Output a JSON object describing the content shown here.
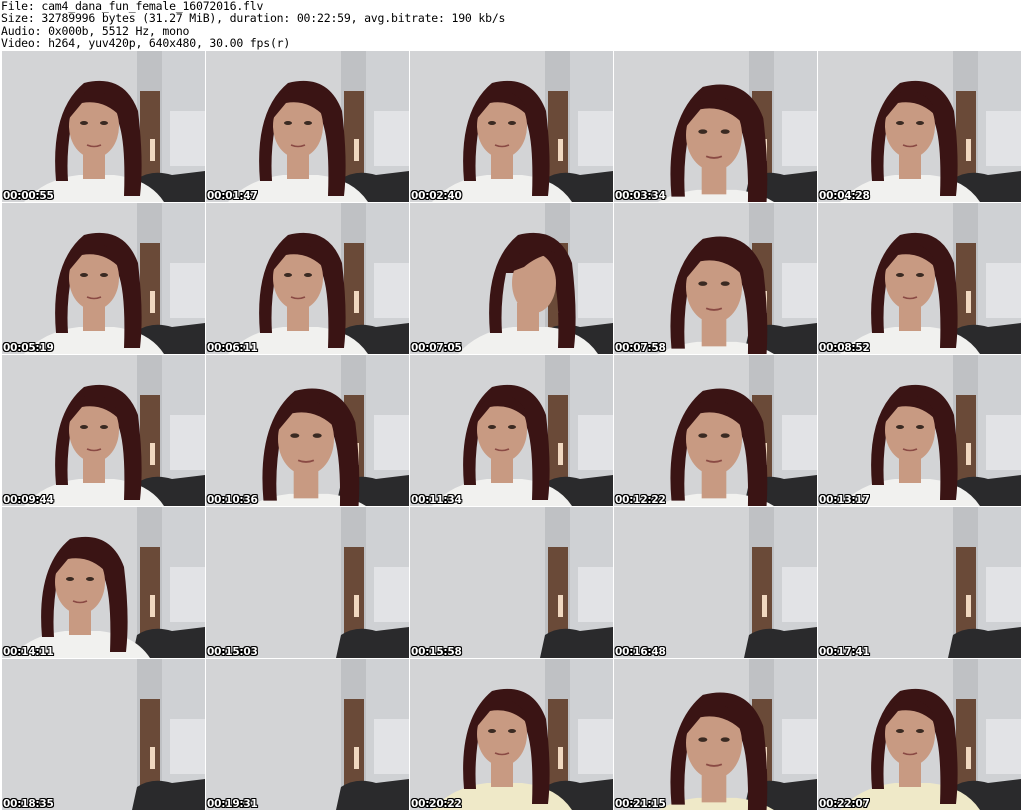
{
  "header": {
    "file_line": "File: cam4_dana_fun_female_16072016.flv",
    "size_line": "Size: 32789996 bytes (31.27 MiB), duration: 00:22:59, avg.bitrate: 190 kb/s",
    "audio_line": "Audio: 0x000b, 5512 Hz, mono",
    "video_line": "Video: h264, yuv420p, 640x480, 30.00 fps(r)"
  },
  "thumbnails": [
    {
      "time": "00:00:55",
      "person": "face"
    },
    {
      "time": "00:01:47",
      "person": "face"
    },
    {
      "time": "00:02:40",
      "person": "face-down"
    },
    {
      "time": "00:03:34",
      "person": "face-close"
    },
    {
      "time": "00:04:28",
      "person": "face"
    },
    {
      "time": "00:05:19",
      "person": "face"
    },
    {
      "time": "00:06:11",
      "person": "face"
    },
    {
      "time": "00:07:05",
      "person": "profile"
    },
    {
      "time": "00:07:58",
      "person": "face-close"
    },
    {
      "time": "00:08:52",
      "person": "face"
    },
    {
      "time": "00:09:44",
      "person": "face"
    },
    {
      "time": "00:10:36",
      "person": "face-close"
    },
    {
      "time": "00:11:34",
      "person": "face"
    },
    {
      "time": "00:12:22",
      "person": "face-close"
    },
    {
      "time": "00:13:17",
      "person": "face"
    },
    {
      "time": "00:14:11",
      "person": "face-left"
    },
    {
      "time": "00:15:03",
      "person": "none"
    },
    {
      "time": "00:15:58",
      "person": "none"
    },
    {
      "time": "00:16:48",
      "person": "none"
    },
    {
      "time": "00:17:41",
      "person": "none"
    },
    {
      "time": "00:18:35",
      "person": "none"
    },
    {
      "time": "00:19:31",
      "person": "none"
    },
    {
      "time": "00:20:22",
      "person": "face-yellow"
    },
    {
      "time": "00:21:15",
      "person": "face-yellow-close"
    },
    {
      "time": "00:22:07",
      "person": "face-yellow"
    }
  ],
  "colors": {
    "wall": "#d3d4d6",
    "door": "#6a4a38",
    "hair": "#3a1414",
    "skin": "#c89a82",
    "shirt_white": "#f1f1ef",
    "shirt_yellow": "#efe9c8",
    "timestamp_text": "#ffffff"
  }
}
